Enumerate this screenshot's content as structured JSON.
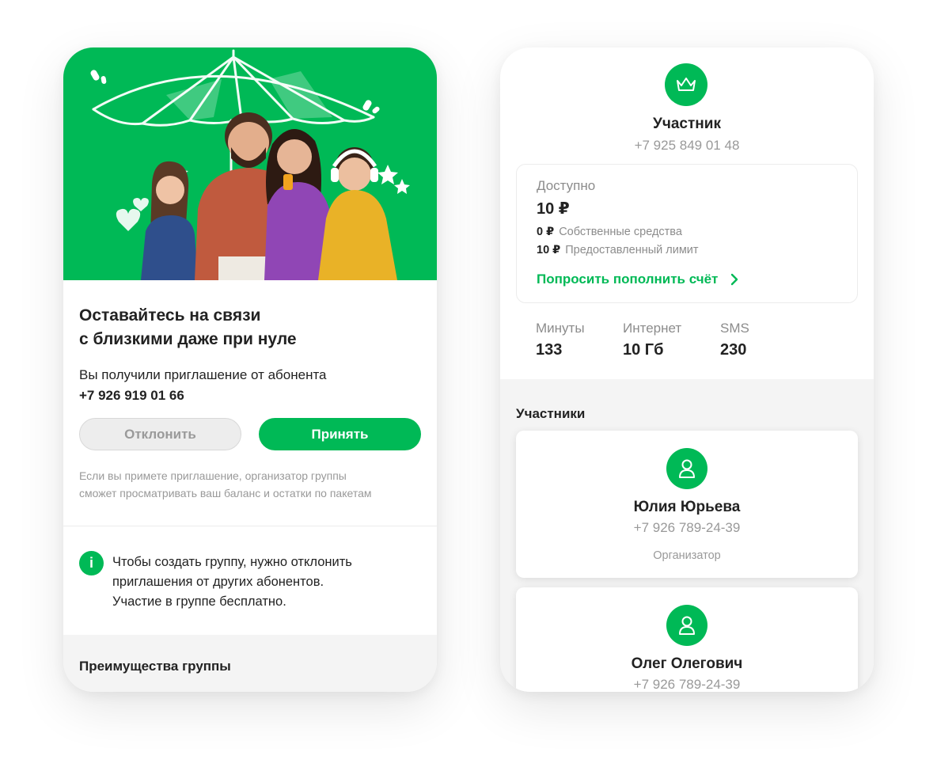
{
  "left": {
    "title_line1": "Оставайтесь на связи",
    "title_line2": "с близкими даже при нуле",
    "invite_text": "Вы получили приглашение от абонента",
    "inviter_phone": "+7 926 919 01 66",
    "decline_label": "Отклонить",
    "accept_label": "Принять",
    "note_line1": "Если вы примете приглашение, организатор группы",
    "note_line2": "сможет просматривать ваш баланс и остатки по пакетам",
    "info_icon": "i",
    "info_line1": "Чтобы создать группу, нужно отклонить",
    "info_line2": "приглашения от других абонентов.",
    "info_line3": "Участие в группе бесплатно.",
    "advantages_title": "Преимущества группы"
  },
  "right": {
    "role": "Участник",
    "phone": "+7 925 849 01 48",
    "balance": {
      "label": "Доступно",
      "amount": "10 ₽",
      "own_value": "0 ₽",
      "own_label": "Собственные средства",
      "limit_value": "10 ₽",
      "limit_label": "Предоставленный лимит",
      "request_link": "Попросить пополнить счёт"
    },
    "stats": [
      {
        "label": "Минуты",
        "value": "133"
      },
      {
        "label": "Интернет",
        "value": "10 Гб"
      },
      {
        "label": "SMS",
        "value": "230"
      }
    ],
    "members_title": "Участники",
    "members": [
      {
        "name": "Юлия Юрьева",
        "phone": "+7 926 789-24-39",
        "role": "Организатор"
      },
      {
        "name": "Олег Олегович",
        "phone": "+7 926 789-24-39"
      }
    ]
  },
  "colors": {
    "brand_green": "#00b956",
    "text_primary": "#222222",
    "text_secondary": "#999999",
    "section_bg": "#f4f4f4"
  },
  "icons": [
    "crown-icon",
    "user-icon",
    "chevron-right-icon",
    "info-icon",
    "umbrella-illustration"
  ]
}
